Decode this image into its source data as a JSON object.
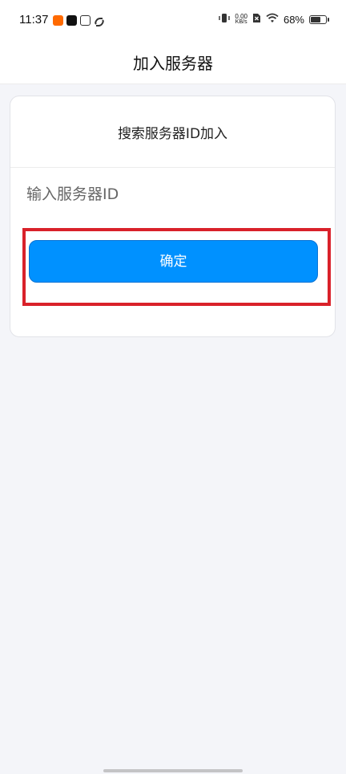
{
  "status_bar": {
    "time": "11:37",
    "net_speed_value": "0.00",
    "net_speed_unit": "KB/s",
    "battery_percent": "68%",
    "battery_level": 0.68
  },
  "header": {
    "title": "加入服务器"
  },
  "card": {
    "title": "搜索服务器ID加入",
    "input_placeholder": "输入服务器ID",
    "input_value": "",
    "confirm_label": "确定"
  },
  "colors": {
    "accent": "#0091ff",
    "highlight": "#d9212a",
    "background": "#f4f5f9"
  }
}
